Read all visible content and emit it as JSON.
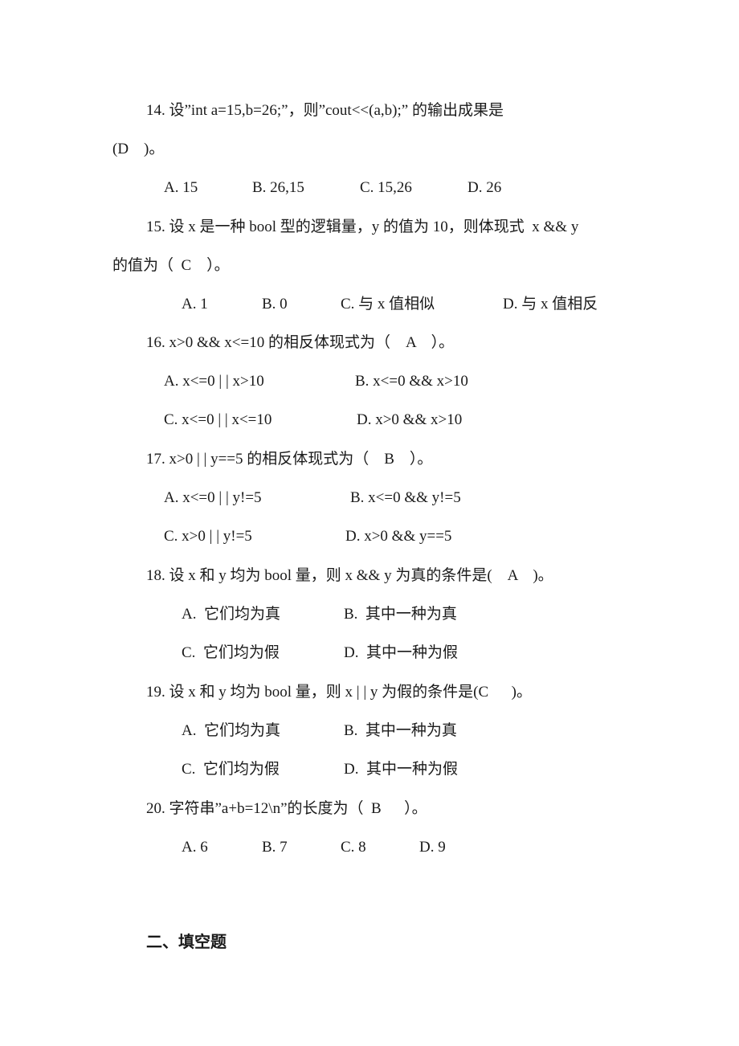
{
  "questions": [
    {
      "number": "14.",
      "stem_lines": [
        "14. 设”int a=15,b=26;”，则”cout<<(a,b);” 的输出成果是",
        "(D    )。"
      ],
      "answer": "D",
      "options": [
        "A. 15",
        "B. 26,15",
        "C. 15,26",
        "D. 26"
      ]
    },
    {
      "number": "15.",
      "stem_lines": [
        "15. 设 x 是一种 bool 型的逻辑量，y 的值为 10，则体现式  x && y",
        "的值为（  C    ）。"
      ],
      "answer": "C",
      "options": [
        "A. 1",
        "B. 0",
        "C. 与 x 值相似",
        "D. 与 x 值相反"
      ]
    },
    {
      "number": "16.",
      "stem_lines": [
        "16. x>0 && x<=10 的相反体现式为（    A    ）。"
      ],
      "answer": "A",
      "options": [
        "A. x<=0 | | x>10",
        "B. x<=0 && x>10",
        "C. x<=0 | | x<=10",
        "D. x>0 && x>10"
      ]
    },
    {
      "number": "17.",
      "stem_lines": [
        "17. x>0 | | y==5 的相反体现式为（    B    ）。"
      ],
      "answer": "B",
      "options": [
        "A. x<=0 | | y!=5",
        "B. x<=0 && y!=5",
        "C. x>0 | | y!=5",
        "D. x>0 && y==5"
      ]
    },
    {
      "number": "18.",
      "stem_lines": [
        "18. 设 x 和 y 均为 bool 量，则 x && y 为真的条件是(    A    )。"
      ],
      "answer": "A",
      "options": [
        "A.  它们均为真",
        "B.  其中一种为真",
        "C.  它们均为假",
        "D.  其中一种为假"
      ]
    },
    {
      "number": "19.",
      "stem_lines": [
        "19. 设 x 和 y 均为 bool 量，则 x | | y 为假的条件是(C      )。"
      ],
      "answer": "C",
      "options": [
        "A.  它们均为真",
        "B.  其中一种为真",
        "C.  它们均为假",
        "D.  其中一种为假"
      ]
    },
    {
      "number": "20.",
      "stem_lines": [
        "20. 字符串”a+b=12\\n”的长度为（  B      ）。"
      ],
      "answer": "B",
      "options": [
        "A. 6",
        "B. 7",
        "C. 8",
        "D. 9"
      ]
    }
  ],
  "section_heading": "二、填空题"
}
